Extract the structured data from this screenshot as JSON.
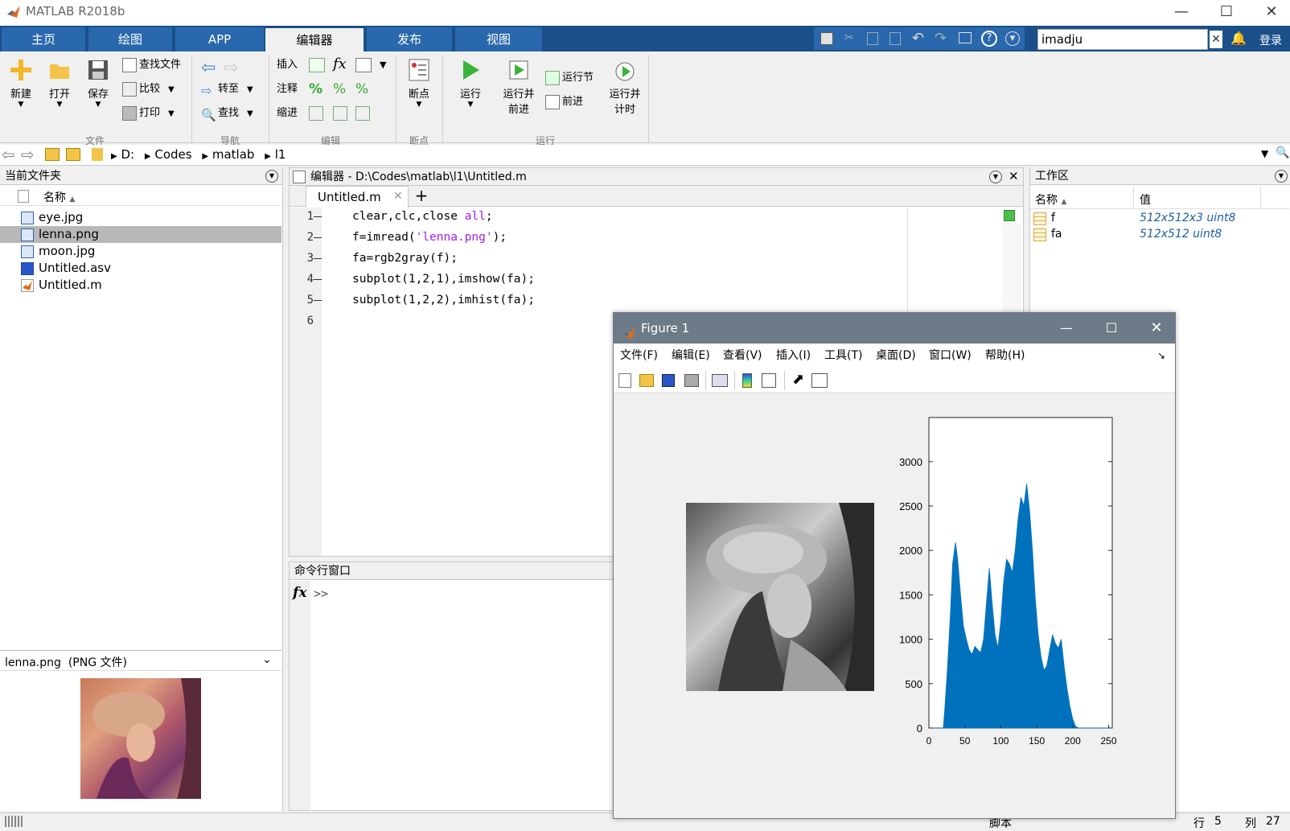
{
  "window": {
    "title": "MATLAB R2018b"
  },
  "tabs": [
    {
      "label": "主页"
    },
    {
      "label": "绘图"
    },
    {
      "label": "APP"
    },
    {
      "label": "编辑器"
    },
    {
      "label": "发布"
    },
    {
      "label": "视图"
    }
  ],
  "search": {
    "value": "imadju",
    "login": "登录"
  },
  "ribbon": {
    "file": {
      "new": "新建",
      "open": "打开",
      "save": "保存",
      "find_files": "查找文件",
      "compare": "比较",
      "print": "打印",
      "group": "文件"
    },
    "nav": {
      "goto": "转至",
      "find": "查找",
      "group": "导航"
    },
    "edit": {
      "insert": "插入",
      "comment": "注释",
      "indent": "缩进",
      "group": "编辑"
    },
    "breakpoints": {
      "label": "断点",
      "group": "断点"
    },
    "run": {
      "run": "运行",
      "run_advance_1": "运行并",
      "run_advance_2": "前进",
      "run_section": "运行节",
      "advance": "前进",
      "run_time_1": "运行并",
      "run_time_2": "计时",
      "group": "运行"
    }
  },
  "address": {
    "parts": [
      "D:",
      "Codes",
      "matlab",
      "l1"
    ]
  },
  "current_folder": {
    "title": "当前文件夹",
    "col_name": "名称",
    "files": [
      "eye.jpg",
      "lenna.png",
      "moon.jpg",
      "Untitled.asv",
      "Untitled.m"
    ],
    "selected": "lenna.png",
    "details_title": "lenna.png  (PNG 文件)"
  },
  "editor": {
    "title": "编辑器 - D:\\Codes\\matlab\\l1\\Untitled.m",
    "tab": "Untitled.m",
    "line_numbers": [
      "1",
      "2",
      "3",
      "4",
      "5",
      "6"
    ],
    "lines": [
      {
        "pre": "clear,clc,close ",
        "str": "all",
        "post": ";"
      },
      {
        "pre": "f=imread(",
        "str": "'lenna.png'",
        "post": ");"
      },
      {
        "pre": "fa=rgb2gray(f);",
        "str": "",
        "post": ""
      },
      {
        "pre": "subplot(1,2,1),imshow(fa);",
        "str": "",
        "post": ""
      },
      {
        "pre": "subplot(1,2,2),imhist(fa);",
        "str": "",
        "post": ""
      }
    ]
  },
  "command_window": {
    "title": "命令行窗口",
    "prompt": ">>"
  },
  "workspace": {
    "title": "工作区",
    "col_name": "名称",
    "col_value": "值",
    "vars": [
      {
        "name": "f",
        "value": "512x512x3 uint8"
      },
      {
        "name": "fa",
        "value": "512x512 uint8"
      }
    ]
  },
  "status": {
    "mode": "脚本",
    "row_label": "行",
    "row": "5",
    "col_label": "列",
    "col": "27"
  },
  "figure": {
    "title": "Figure 1",
    "menu": [
      "文件(F)",
      "编辑(E)",
      "查看(V)",
      "插入(I)",
      "工具(T)",
      "桌面(D)",
      "窗口(W)",
      "帮助(H)"
    ]
  },
  "chart_data": {
    "type": "area",
    "xlim": [
      0,
      255
    ],
    "ylim": [
      0,
      3000
    ],
    "yticks": [
      0,
      500,
      1000,
      1500,
      2000,
      2500,
      3000
    ],
    "xticks": [
      0,
      50,
      100,
      150,
      200,
      250
    ],
    "color": "#0072bd",
    "x": [
      0,
      10,
      15,
      20,
      22,
      26,
      30,
      33,
      37,
      40,
      44,
      48,
      52,
      56,
      60,
      64,
      68,
      72,
      76,
      80,
      84,
      88,
      92,
      96,
      100,
      104,
      108,
      112,
      116,
      120,
      124,
      128,
      132,
      136,
      140,
      144,
      148,
      152,
      156,
      160,
      164,
      168,
      172,
      176,
      180,
      184,
      188,
      192,
      196,
      200,
      204,
      208,
      212,
      216,
      220,
      224,
      230,
      255
    ],
    "y": [
      0,
      0,
      0,
      0,
      200,
      700,
      1300,
      1850,
      2090,
      1900,
      1500,
      1150,
      1000,
      880,
      830,
      920,
      880,
      850,
      1000,
      1400,
      1800,
      1400,
      1050,
      900,
      1200,
      1650,
      1900,
      1850,
      1750,
      2000,
      2350,
      2600,
      2500,
      2750,
      2450,
      2000,
      1450,
      1050,
      800,
      650,
      700,
      880,
      1050,
      950,
      900,
      1000,
      700,
      450,
      250,
      100,
      20,
      0,
      0,
      0,
      0,
      0,
      0,
      0
    ]
  }
}
